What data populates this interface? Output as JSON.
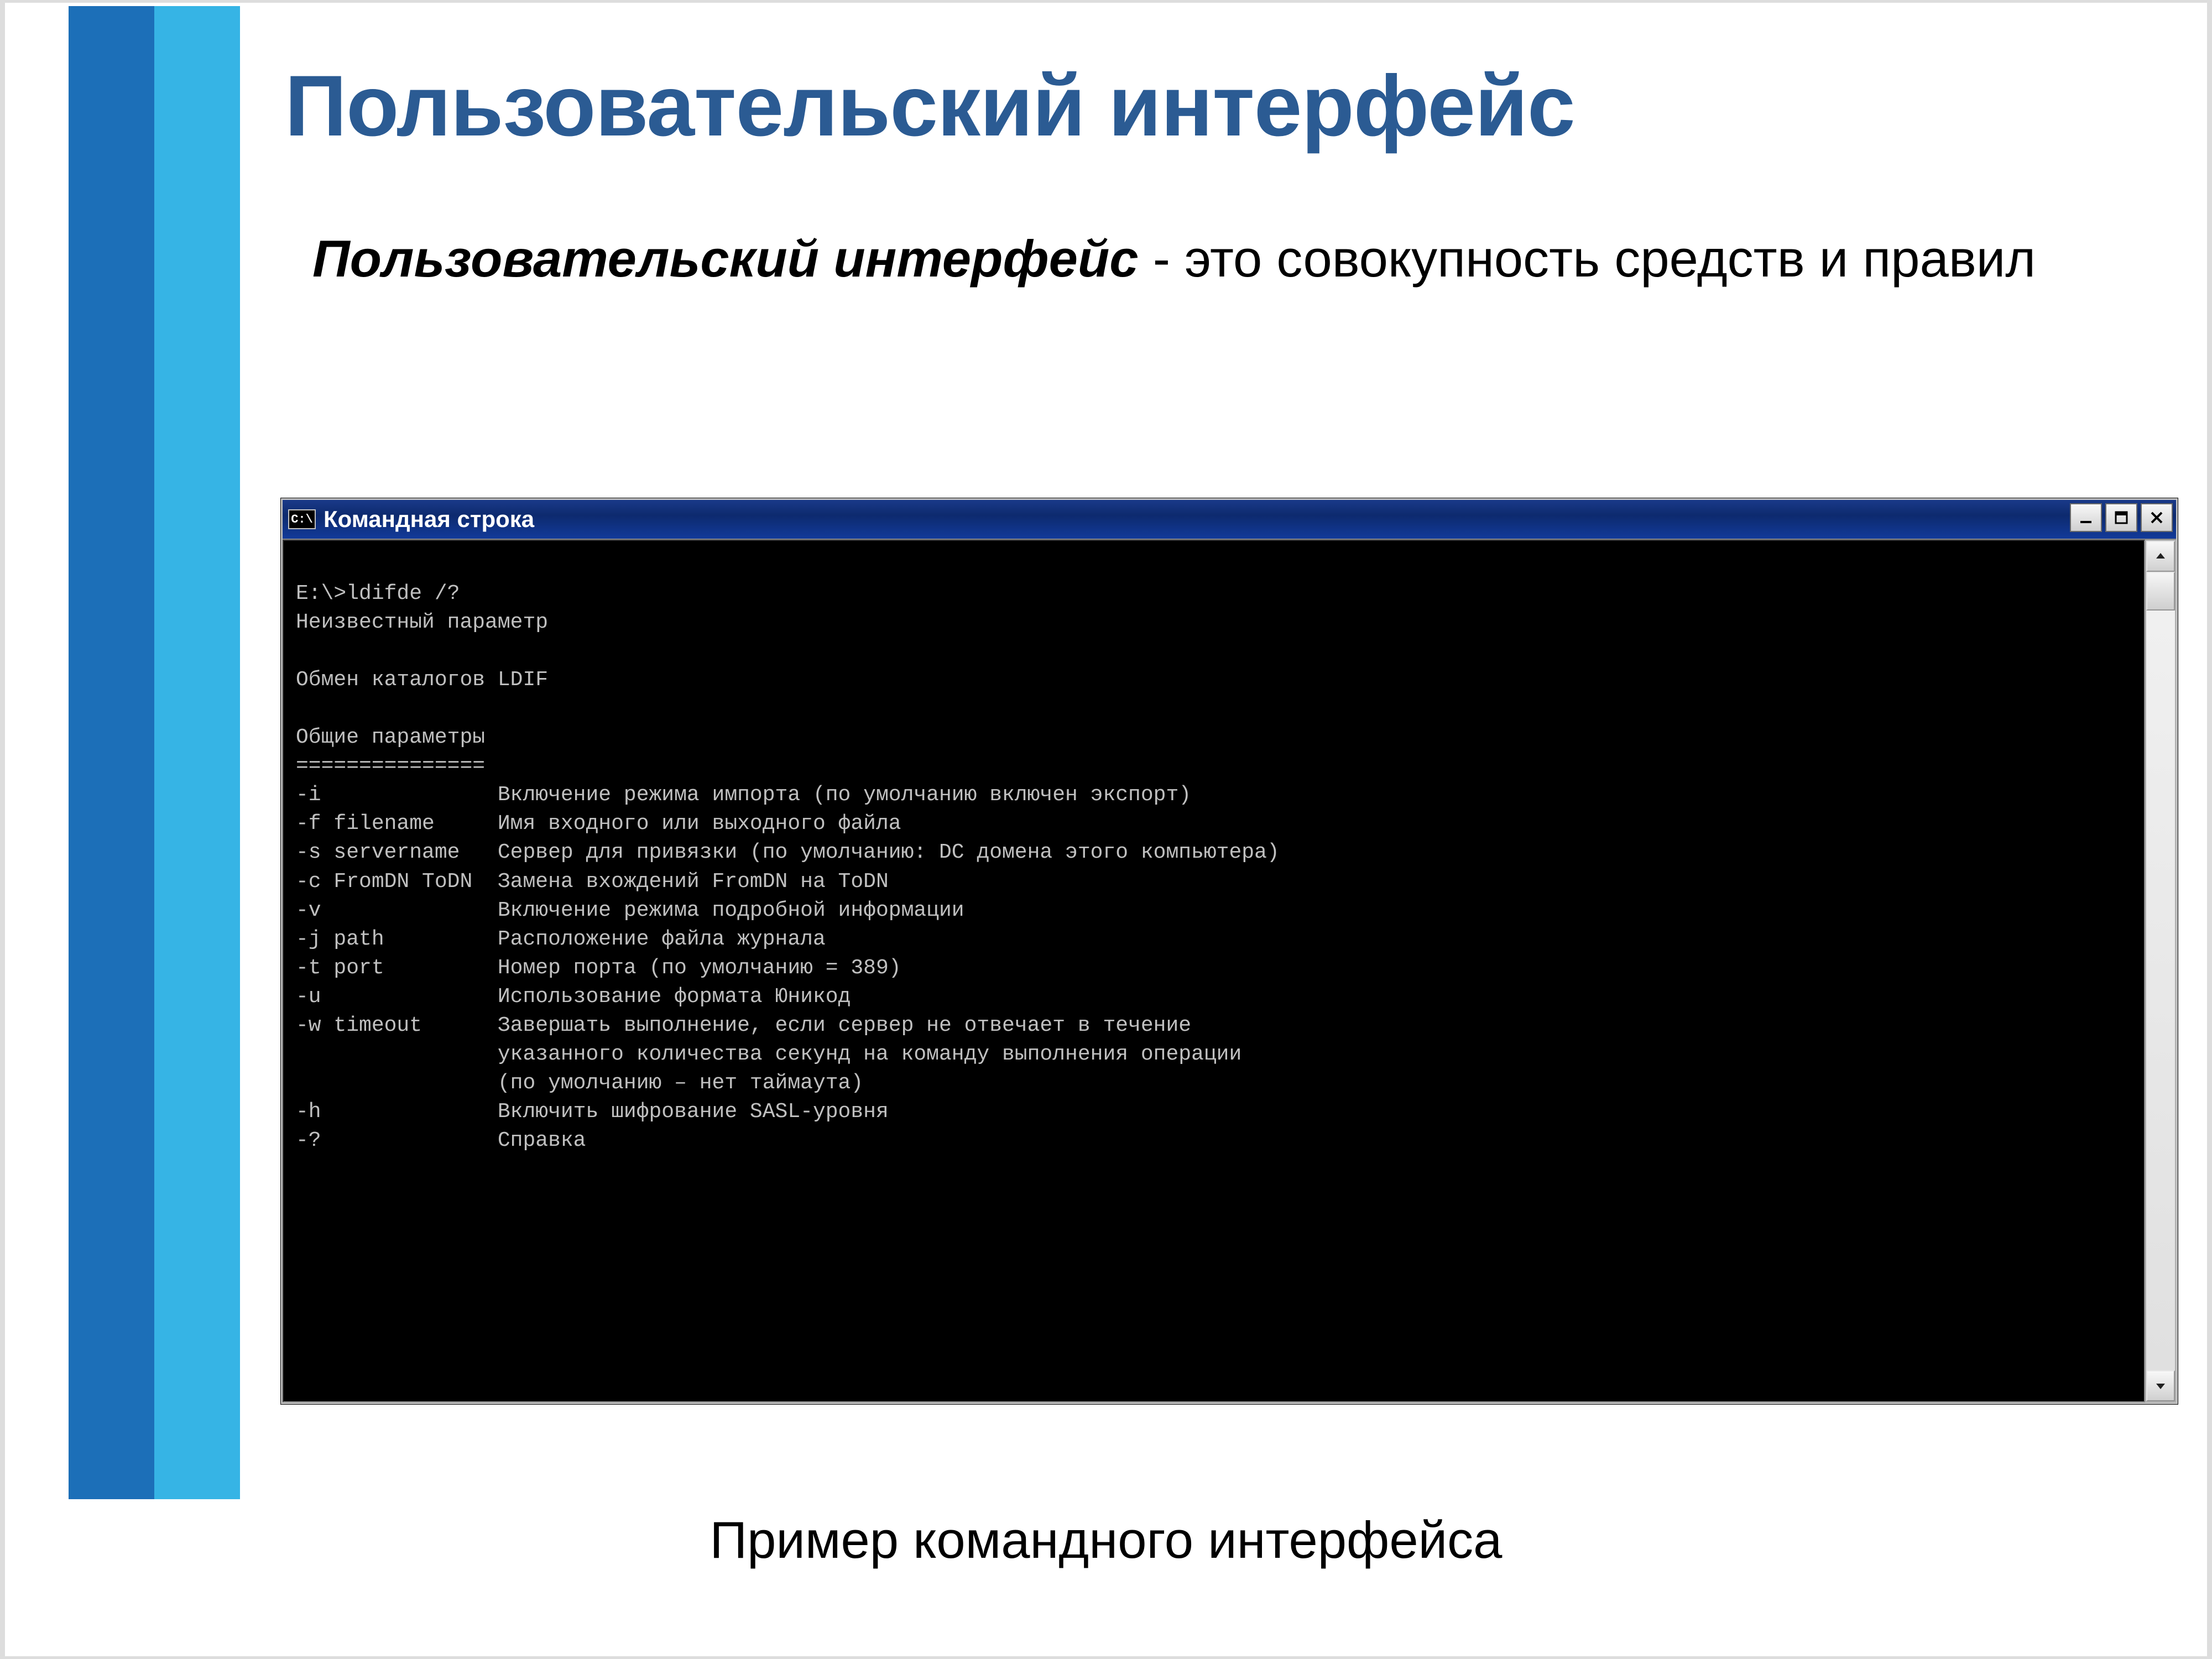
{
  "slide": {
    "title": "Пользовательский интерфейс",
    "definition_term": "Пользовательский интерфейс",
    "definition_rest": " - это совокупность средств и правил",
    "caption": "Пример командного интерфейса"
  },
  "cmd": {
    "icon_text": "C:\\",
    "title": "Командная строка",
    "buttons": {
      "min": "minimize",
      "max": "maximize",
      "close": "close"
    },
    "lines": [
      "",
      "E:\\>ldifde /?",
      "Неизвестный параметр",
      "",
      "Обмен каталогов LDIF",
      "",
      "Общие параметры",
      "===============",
      "-i              Включение режима импорта (по умолчанию включен экспорт)",
      "-f filename     Имя входного или выходного файла",
      "-s servername   Сервер для привязки (по умолчанию: DC домена этого компьютера)",
      "-c FromDN ToDN  Замена вхождений FromDN на ToDN",
      "-v              Включение режима подробной информации",
      "-j path         Расположение файла журнала",
      "-t port         Номер порта (по умолчанию = 389)",
      "-u              Использование формата Юникод",
      "-w timeout      Завершать выполнение, если сервер не отвечает в течение",
      "                указанного количества секунд на команду выполнения операции",
      "                (по умолчанию – нет таймаута)",
      "-h              Включить шифрование SASL-уровня",
      "-?              Справка",
      ""
    ]
  },
  "colors": {
    "accent_dark": "#1c6fb8",
    "accent_light": "#36b4e5",
    "title": "#2b5b93"
  }
}
